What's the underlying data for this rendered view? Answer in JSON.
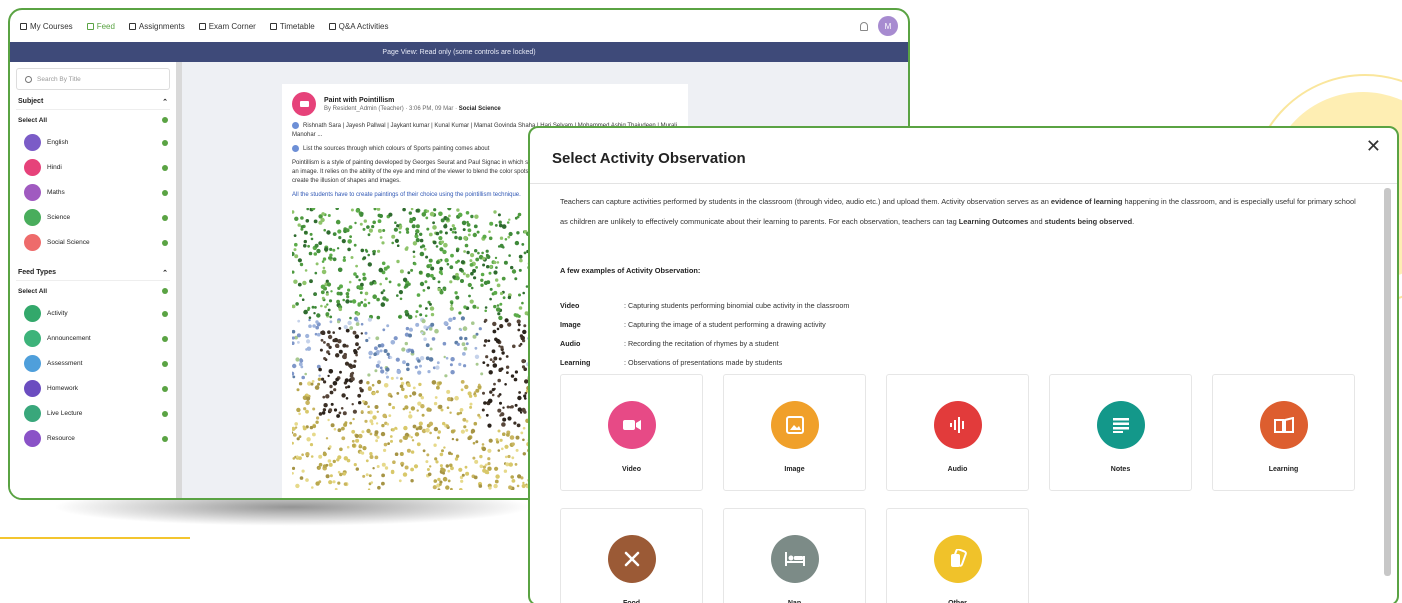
{
  "nav": {
    "items": [
      {
        "label": "My Courses",
        "active": false
      },
      {
        "label": "Feed",
        "active": true
      },
      {
        "label": "Assignments",
        "active": false
      },
      {
        "label": "Exam Corner",
        "active": false
      },
      {
        "label": "Timetable",
        "active": false
      },
      {
        "label": "Q&A Activities",
        "active": false
      }
    ],
    "avatar_initial": "M"
  },
  "banner": "Page View: Read only (some controls are locked)",
  "sidebar": {
    "search_placeholder": "Search By Title",
    "subject_header": "Subject",
    "subject_select_all": "Select All",
    "subjects": [
      {
        "label": "English",
        "color": "#7b5cc7",
        "abbr": "En"
      },
      {
        "label": "Hindi",
        "color": "#e6427a",
        "abbr": "ह"
      },
      {
        "label": "Maths",
        "color": "#a05ac0",
        "abbr": "∑"
      },
      {
        "label": "Science",
        "color": "#49ad5c",
        "abbr": "⚗"
      },
      {
        "label": "Social Science",
        "color": "#ee6b6b",
        "abbr": "◎"
      }
    ],
    "feed_header": "Feed Types",
    "feed_select_all": "Select All",
    "feed_types": [
      {
        "label": "Activity",
        "color": "#33a86b"
      },
      {
        "label": "Announcement",
        "color": "#3db37a"
      },
      {
        "label": "Assessment",
        "color": "#4f9fdb"
      },
      {
        "label": "Homework",
        "color": "#6b4dc0"
      },
      {
        "label": "Live Lecture",
        "color": "#39a77b"
      },
      {
        "label": "Resource",
        "color": "#8a52c7"
      }
    ]
  },
  "post": {
    "title": "Paint with Pointillism",
    "author": "By Resident_Admin (Teacher)",
    "time": "3:06 PM, 09 Mar",
    "subject": "Social Science",
    "tagged": "Rishnath Sara | Jayesh Pallwal | Jaykant kumar | Kunal Kumar | Mamat Govinda Shaha | Hari Selvam | Mohammed Ashiq Thajudeen | Murali Manohar ...",
    "outcome": "List the sources through which colours of Sports painting comes about",
    "description": "Pointillism is a style of painting developed by Georges Seurat and Paul Signac in which small, distinct dots of color are applied in patterns to form an image. It relies on the ability of the eye and mind of the viewer to blend the color spots into a fuller range of tones. It uses small dots of color to create the illusion of shapes and images.",
    "instruction": "All the students have to create paintings of their choice using the pointillism technique."
  },
  "modal": {
    "title": "Select Activity Observation",
    "close_label": "✕",
    "intro_a": "Teachers can capture activities performed by students in the classroom (through video, audio etc.) and upload them. Activity observation serves as an ",
    "intro_b": "evidence of learning",
    "intro_c": " happening in the classroom, and is especially useful for primary school as children are unlikely to effectively communicate about their learning to parents. For each observation, teachers can tag ",
    "intro_d": "Learning Outcomes",
    "intro_e": " and ",
    "intro_f": "students being observed",
    "intro_g": ".",
    "examples_title": "A few examples of Activity Observation:",
    "examples": [
      {
        "key": "Video",
        "value": ": Capturing students performing binomial cube activity in the classroom"
      },
      {
        "key": "Image",
        "value": ": Capturing the image of a student performing a drawing activity"
      },
      {
        "key": "Audio",
        "value": ": Recording the recitation of rhymes by a student"
      },
      {
        "key": "Learning",
        "value": ": Observations of presentations made by students"
      }
    ],
    "tiles": [
      {
        "label": "Video",
        "color": "#e74a86",
        "icon": "video-icon"
      },
      {
        "label": "Image",
        "color": "#f0a02a",
        "icon": "image-icon"
      },
      {
        "label": "Audio",
        "color": "#e23b3b",
        "icon": "audio-icon"
      },
      {
        "label": "Notes",
        "color": "#13988a",
        "icon": "notes-icon"
      },
      {
        "label": "Learning",
        "color": "#dd5e2f",
        "icon": "learning-icon"
      },
      {
        "label": "Food",
        "color": "#9b5a36",
        "icon": "food-icon"
      },
      {
        "label": "Nap",
        "color": "#7c8b87",
        "icon": "nap-icon"
      },
      {
        "label": "Other",
        "color": "#f0c22a",
        "icon": "other-icon"
      }
    ]
  }
}
